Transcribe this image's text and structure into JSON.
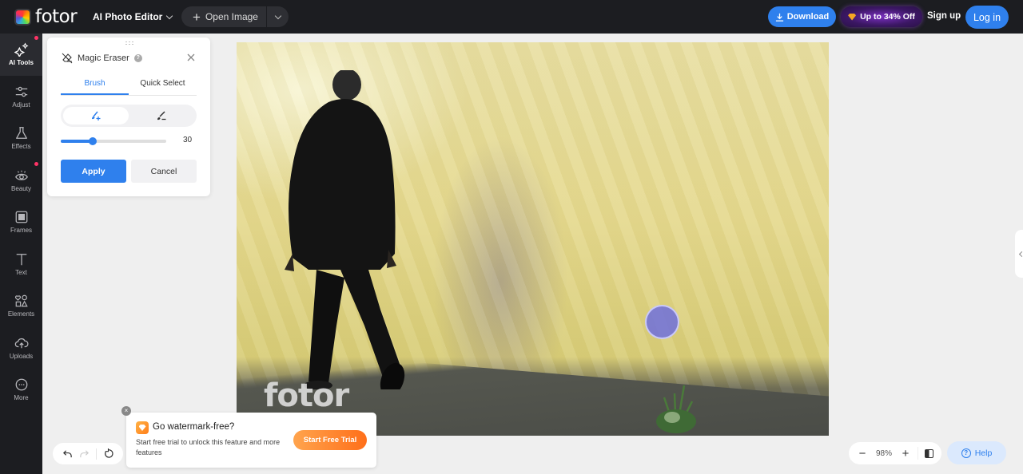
{
  "header": {
    "logo_text": "fotor",
    "product_label": "AI Photo Editor",
    "open_image_label": "Open Image",
    "download_label": "Download",
    "promo_label": "Up to 34% Off",
    "signup_label": "Sign up",
    "login_label": "Log in"
  },
  "sidebar": {
    "items": [
      {
        "label": "AI Tools",
        "icon": "sparkle-icon",
        "active": true,
        "dot": true
      },
      {
        "label": "Adjust",
        "icon": "sliders-icon",
        "active": false,
        "dot": false
      },
      {
        "label": "Effects",
        "icon": "flask-icon",
        "active": false,
        "dot": false
      },
      {
        "label": "Beauty",
        "icon": "eye-icon",
        "active": false,
        "dot": true
      },
      {
        "label": "Frames",
        "icon": "frame-icon",
        "active": false,
        "dot": false
      },
      {
        "label": "Text",
        "icon": "text-icon",
        "active": false,
        "dot": false
      },
      {
        "label": "Elements",
        "icon": "shapes-icon",
        "active": false,
        "dot": false
      },
      {
        "label": "Uploads",
        "icon": "cloud-upload-icon",
        "active": false,
        "dot": false
      },
      {
        "label": "More",
        "icon": "more-icon",
        "active": false,
        "dot": false
      }
    ]
  },
  "panel": {
    "title": "Magic Eraser",
    "help": "?",
    "tabs": [
      {
        "label": "Brush",
        "active": true
      },
      {
        "label": "Quick Select",
        "active": false
      }
    ],
    "modes": [
      {
        "name": "brush-add",
        "active": true
      },
      {
        "name": "brush-erase",
        "active": false
      }
    ],
    "brush_size": {
      "value": "30",
      "fraction": 0.3
    },
    "apply_label": "Apply",
    "cancel_label": "Cancel"
  },
  "canvas": {
    "watermark": "fotor"
  },
  "promo": {
    "close": "×",
    "title": "Go watermark-free?",
    "description": "Start free trial to unlock this feature and more features",
    "button_label": "Start Free Trial"
  },
  "zoom": {
    "minus": "−",
    "value": "98%",
    "plus": "+"
  },
  "help": {
    "label": "Help",
    "glyph": "?"
  },
  "colors": {
    "accent": "#2f80ed",
    "promo_orange": "#ff7e1a",
    "notification_dot": "#ff3366"
  }
}
